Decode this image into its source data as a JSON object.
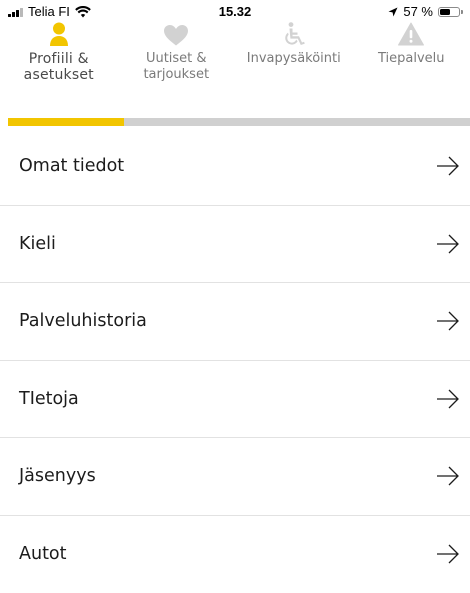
{
  "status_bar": {
    "carrier": "Telia FI",
    "time": "15.32",
    "battery": "57 %",
    "battery_level": 0.57,
    "icons": [
      "cellular-signal-icon",
      "wifi-icon",
      "location-arrow-icon",
      "battery-icon"
    ]
  },
  "tabs": [
    {
      "label": "Profiili &\nasetukset",
      "icon": "person-icon",
      "active": true
    },
    {
      "label": "Uutiset &\ntarjoukset",
      "icon": "heart-icon",
      "active": false
    },
    {
      "label": "Invapysäköinti",
      "icon": "wheelchair-icon",
      "active": false
    },
    {
      "label": "Tiepalvelu",
      "icon": "warning-triangle-icon",
      "active": false
    }
  ],
  "menu": {
    "items": [
      {
        "label": "Omat tiedot"
      },
      {
        "label": "Kieli"
      },
      {
        "label": "Palveluhistoria"
      },
      {
        "label": "TIetoja"
      },
      {
        "label": "Jäsenyys"
      },
      {
        "label": "Autot"
      }
    ],
    "arrow_icon": "arrow-right-icon"
  },
  "colors": {
    "accent": "#f2c500",
    "indicator_track": "#d0d0d0",
    "inactive_icon": "#d2d2d2",
    "divider": "#e2e2e2",
    "text": "#1c1c1c"
  }
}
